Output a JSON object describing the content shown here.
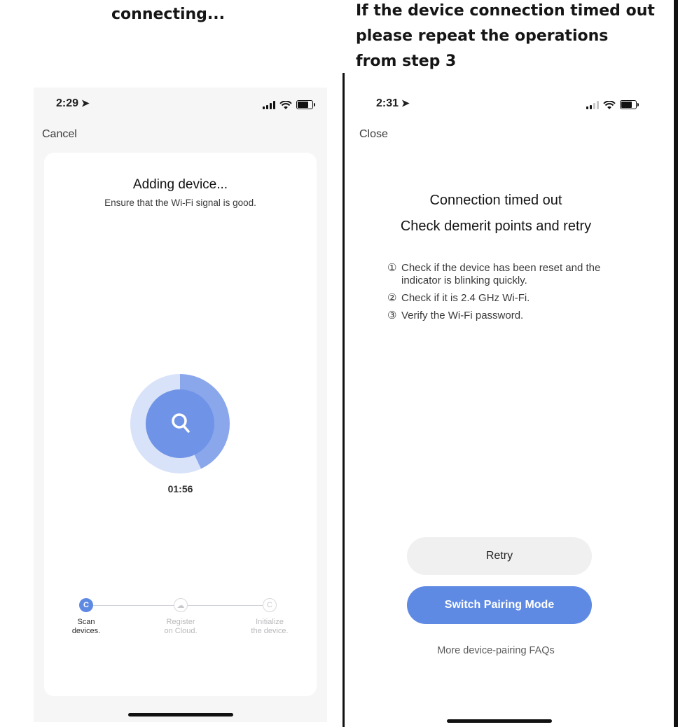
{
  "captions": {
    "left": "connecting...",
    "right_lines": [
      "If the device connection timed out",
      "please repeat the operations",
      "from step 3"
    ]
  },
  "left_screen": {
    "status_time": "2:29",
    "nav": "Cancel",
    "title": "Adding device...",
    "subtitle": "Ensure that the Wi-Fi signal is good.",
    "timer": "01:56",
    "progress_fraction": 0.43,
    "steps": [
      {
        "label": "Scan\ndevices.",
        "state": "active",
        "icon": "refresh-icon"
      },
      {
        "label": "Register\non Cloud.",
        "state": "idle",
        "icon": "cloud-icon"
      },
      {
        "label": "Initialize\nthe device.",
        "state": "idle",
        "icon": "refresh-icon"
      }
    ]
  },
  "right_screen": {
    "status_time": "2:31",
    "nav": "Close",
    "title": "Connection timed out",
    "subtitle": "Check demerit points and retry",
    "tips": [
      {
        "num": "①",
        "text": "Check if the device has been reset and the indicator is blinking quickly."
      },
      {
        "num": "②",
        "text": "Check if it is 2.4 GHz Wi-Fi."
      },
      {
        "num": "③",
        "text": "Verify the Wi-Fi password."
      }
    ],
    "retry_label": "Retry",
    "switch_label": "Switch Pairing Mode",
    "faq_label": "More device-pairing FAQs"
  },
  "colors": {
    "accent": "#5f8ae3",
    "ring_light": "#d8e2f9",
    "ring_mid": "#8aa7ec",
    "card_bg": "#ffffff",
    "screen_bg": "#f6f6f7"
  }
}
